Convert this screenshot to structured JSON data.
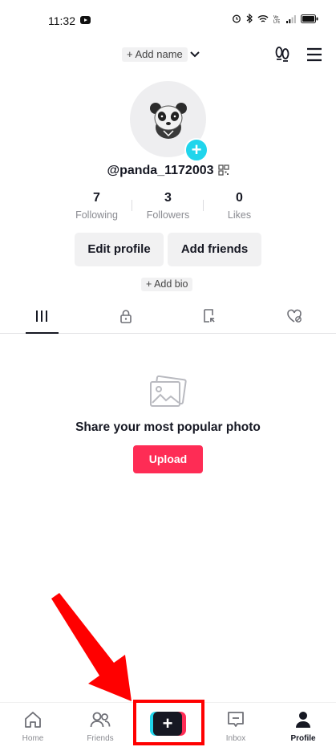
{
  "status_bar": {
    "time": "11:32",
    "battery": "full"
  },
  "header": {
    "add_name_label": "+ Add name"
  },
  "profile": {
    "username": "@panda_1172003",
    "stats": [
      {
        "value": "7",
        "label": "Following"
      },
      {
        "value": "3",
        "label": "Followers"
      },
      {
        "value": "0",
        "label": "Likes"
      }
    ],
    "edit_profile_label": "Edit profile",
    "add_friends_label": "Add friends",
    "add_bio_label": "+ Add bio"
  },
  "tabs": [
    {
      "icon": "grid-icon",
      "active": true
    },
    {
      "icon": "lock-icon",
      "active": false
    },
    {
      "icon": "repost-icon",
      "active": false
    },
    {
      "icon": "liked-icon",
      "active": false
    }
  ],
  "empty_state": {
    "title": "Share your most popular photo",
    "upload_label": "Upload"
  },
  "bottom_nav": {
    "home": "Home",
    "friends": "Friends",
    "inbox": "Inbox",
    "profile": "Profile",
    "create_symbol": "+"
  },
  "colors": {
    "accent": "#fe2c55",
    "teal": "#20d5ec",
    "annotation": "#ff0000"
  }
}
